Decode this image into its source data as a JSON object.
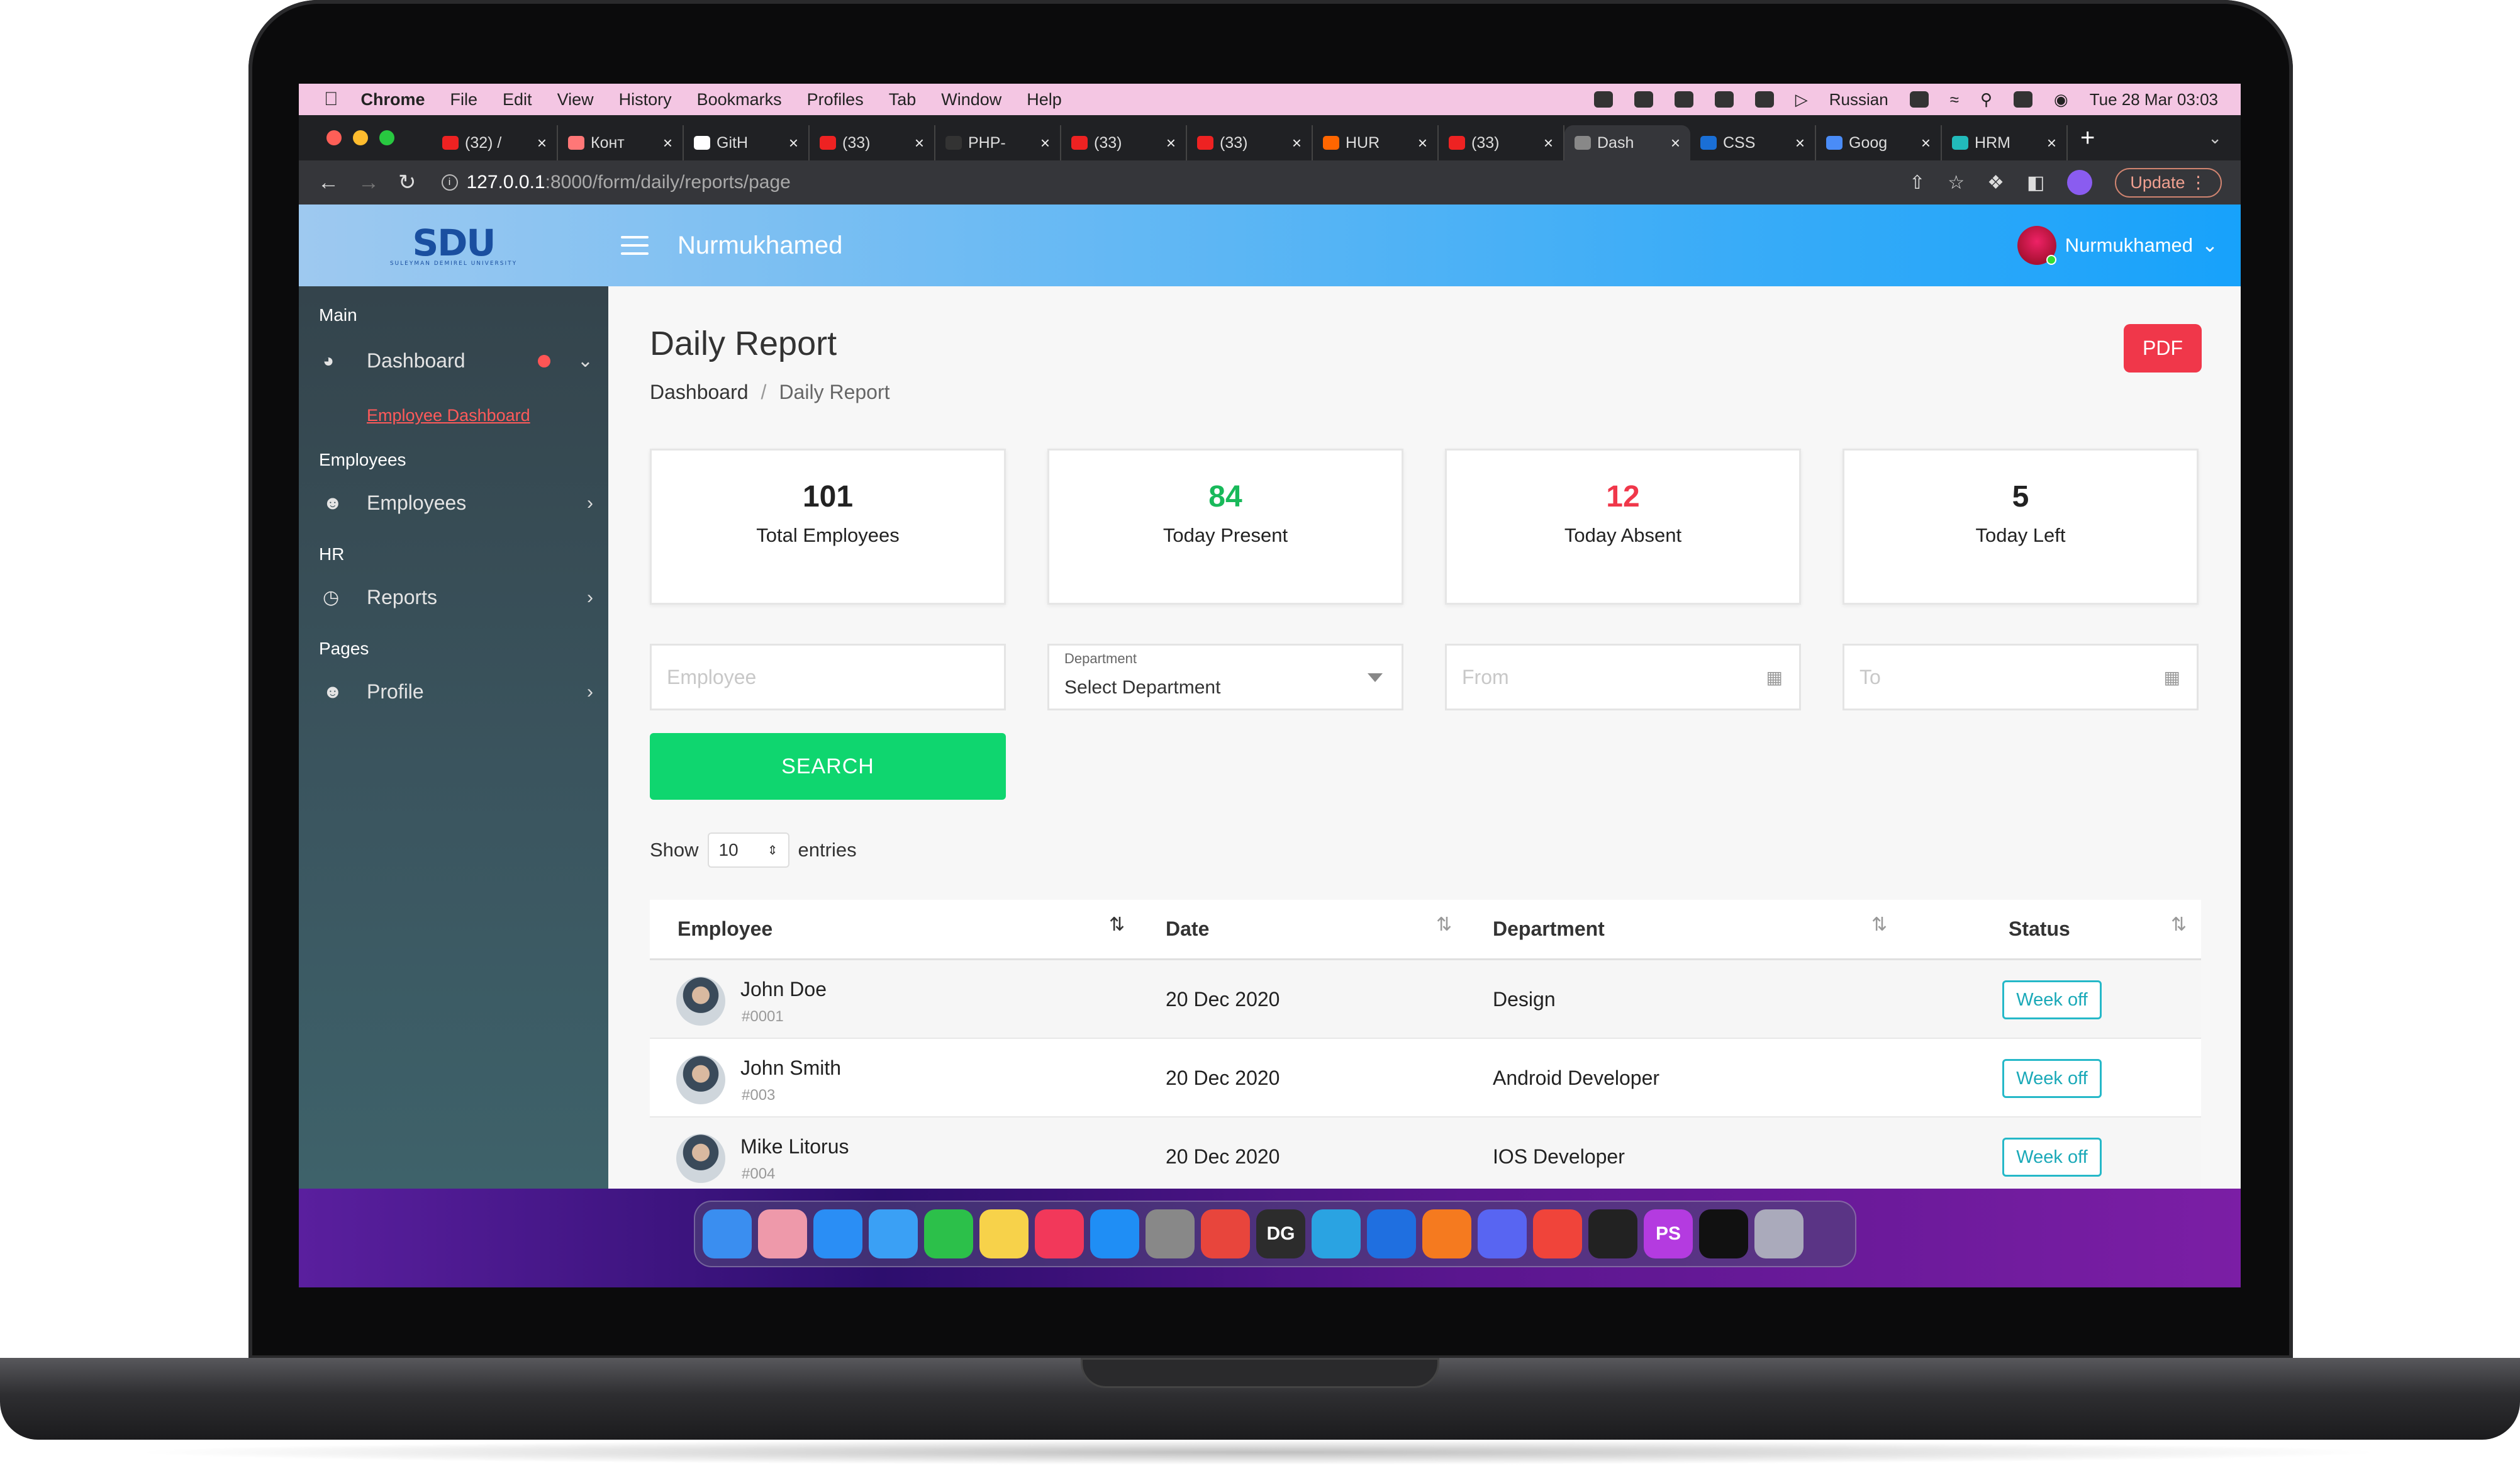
{
  "menubar": {
    "items": [
      "Chrome",
      "File",
      "Edit",
      "View",
      "History",
      "Bookmarks",
      "Profiles",
      "Tab",
      "Window",
      "Help"
    ],
    "language": "Russian",
    "datetime": "Tue 28 Mar  03:03"
  },
  "tabs": [
    {
      "label": "(32) /",
      "color": "#e22"
    },
    {
      "label": "Конт",
      "color": "#f77"
    },
    {
      "label": "GitH",
      "color": "#fff"
    },
    {
      "label": "(33)",
      "color": "#e22"
    },
    {
      "label": "PHP-",
      "color": "#333"
    },
    {
      "label": "(33)",
      "color": "#e22"
    },
    {
      "label": "(33)",
      "color": "#e22"
    },
    {
      "label": "HUR",
      "color": "#f60"
    },
    {
      "label": "(33)",
      "color": "#e22"
    },
    {
      "label": "Dash",
      "color": "#888",
      "active": true
    },
    {
      "label": "CSS",
      "color": "#1a6fd6"
    },
    {
      "label": "Goog",
      "color": "#4a8cf7"
    },
    {
      "label": "HRM",
      "color": "#2bb"
    }
  ],
  "address": {
    "url_host": "127.0.0.1",
    "url_path": ":8000/form/daily/reports/page",
    "update_label": "Update"
  },
  "header": {
    "logo_text": "SDU",
    "logo_sub": "SULEYMAN DEMIREL UNIVERSITY",
    "brand": "Nurmukhamed",
    "user_name": "Nurmukhamed"
  },
  "sidebar": {
    "sections": {
      "main": "Main",
      "employees": "Employees",
      "hr": "HR",
      "pages": "Pages"
    },
    "items": {
      "dashboard": "Dashboard",
      "employee_dashboard": "Employee Dashboard",
      "employees": "Employees",
      "reports": "Reports",
      "profile": "Profile"
    }
  },
  "page": {
    "title": "Daily Report",
    "breadcrumb_home": "Dashboard",
    "breadcrumb_sep": "/",
    "breadcrumb_current": "Daily Report",
    "pdf_label": "PDF"
  },
  "stats": [
    {
      "value": "101",
      "label": "Total Employees",
      "color": "#222"
    },
    {
      "value": "84",
      "label": "Today Present",
      "color": "#18b95a"
    },
    {
      "value": "12",
      "label": "Today Absent",
      "color": "#f0374a"
    },
    {
      "value": "5",
      "label": "Today Left",
      "color": "#222"
    }
  ],
  "filters": {
    "employee_placeholder": "Employee",
    "department_label": "Department",
    "department_value": "Select Department",
    "from_placeholder": "From",
    "to_placeholder": "To",
    "search_label": "SEARCH"
  },
  "entries": {
    "show": "Show",
    "value": "10",
    "suffix": "entries"
  },
  "table": {
    "headers": [
      "Employee",
      "Date",
      "Department",
      "Status"
    ],
    "rows": [
      {
        "name": "John Doe",
        "id": "#0001",
        "date": "20 Dec 2020",
        "department": "Design",
        "status": "Week off"
      },
      {
        "name": "John Smith",
        "id": "#003",
        "date": "20 Dec 2020",
        "department": "Android Developer",
        "status": "Week off"
      },
      {
        "name": "Mike Litorus",
        "id": "#004",
        "date": "20 Dec 2020",
        "department": "IOS Developer",
        "status": "Week off"
      }
    ]
  },
  "dock": {
    "icons": [
      {
        "name": "finder-icon",
        "color": "#3a8ef0"
      },
      {
        "name": "launchpad-icon",
        "color": "#e9a"
      },
      {
        "name": "safari-icon",
        "color": "#2a8ef5"
      },
      {
        "name": "mail-icon",
        "color": "#3aa0f5"
      },
      {
        "name": "facetime-icon",
        "color": "#2cc04a"
      },
      {
        "name": "notes-icon",
        "color": "#f7d24a"
      },
      {
        "name": "music-icon",
        "color": "#f2385a"
      },
      {
        "name": "appstore-icon",
        "color": "#1f8ef5"
      },
      {
        "name": "settings-icon",
        "color": "#888"
      },
      {
        "name": "chrome-icon",
        "color": "#e8453c"
      },
      {
        "name": "datagrip-icon",
        "color": "#2c2c2c",
        "label": "DG"
      },
      {
        "name": "telegram-icon",
        "color": "#2aa3e2"
      },
      {
        "name": "shield-app-icon",
        "color": "#1f6fe0"
      },
      {
        "name": "pen-app-icon",
        "color": "#f57a1f"
      },
      {
        "name": "discord-icon",
        "color": "#5865f2"
      },
      {
        "name": "xmind-icon",
        "color": "#f0443a"
      },
      {
        "name": "terminal-icon",
        "color": "#222"
      },
      {
        "name": "phpstorm-icon",
        "color": "#b43be0",
        "label": "PS"
      },
      {
        "name": "screen-icon",
        "color": "#111"
      },
      {
        "name": "trash-icon",
        "color": "#aab"
      }
    ]
  }
}
